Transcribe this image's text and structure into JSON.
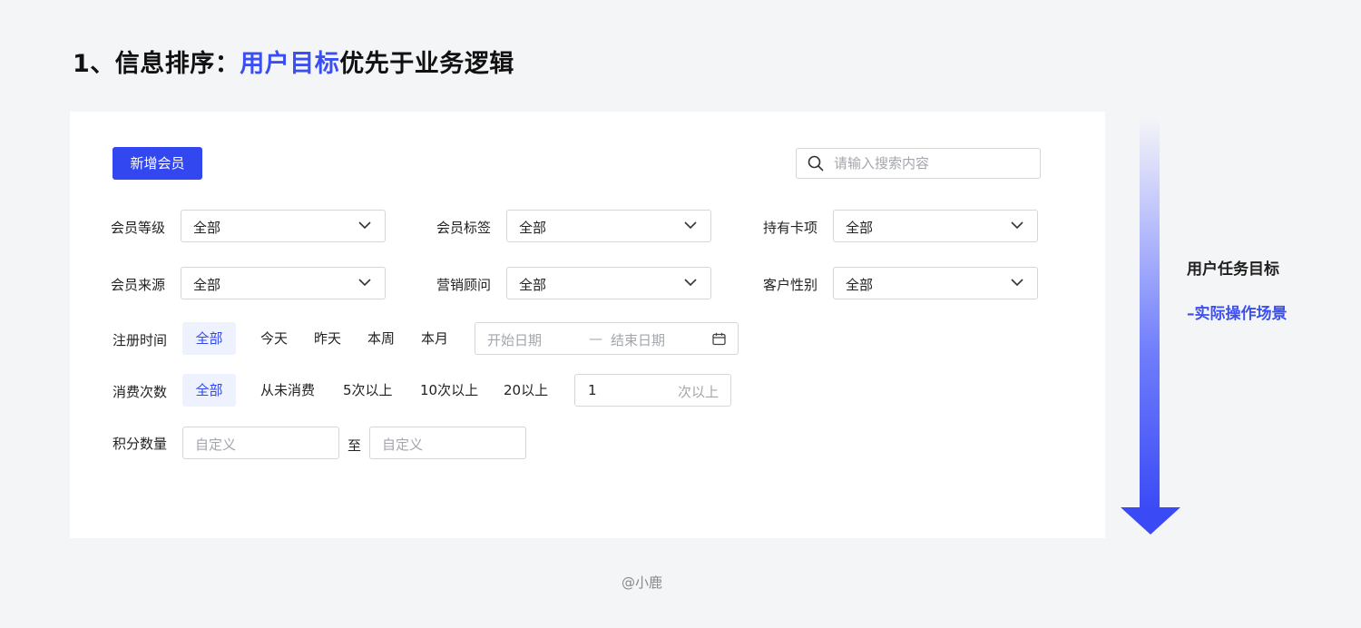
{
  "heading": {
    "prefix": "1、信息排序：",
    "highlight": "用户目标",
    "suffix": "优先于业务逻辑"
  },
  "toolbar": {
    "add_member_label": "新增会员",
    "search_placeholder": "请输入搜索内容"
  },
  "filters": {
    "member_level": {
      "label": "会员等级",
      "value": "全部"
    },
    "member_tag": {
      "label": "会员标签",
      "value": "全部"
    },
    "card_items": {
      "label": "持有卡项",
      "value": "全部"
    },
    "member_source": {
      "label": "会员来源",
      "value": "全部"
    },
    "sales_advisor": {
      "label": "营销顾问",
      "value": "全部"
    },
    "customer_gender": {
      "label": "客户性别",
      "value": "全部"
    }
  },
  "register_time": {
    "label": "注册时间",
    "options": [
      "全部",
      "今天",
      "昨天",
      "本周",
      "本月"
    ],
    "active": "全部",
    "start_placeholder": "开始日期",
    "separator": "—",
    "end_placeholder": "结束日期"
  },
  "consume_count": {
    "label": "消费次数",
    "options": [
      "全部",
      "从未消费",
      "5次以上",
      "10次以上",
      "20以上"
    ],
    "active": "全部",
    "custom_value": "1",
    "custom_unit": "次以上"
  },
  "points": {
    "label": "积分数量",
    "min_placeholder": "自定义",
    "to_label": "至",
    "max_placeholder": "自定义"
  },
  "side": {
    "title": "用户任务目标",
    "subtitle": "–实际操作场景"
  },
  "credit": "@小鹿",
  "colors": {
    "accent": "#3247f0",
    "highlight_text": "#3b4ef3",
    "active_chip_bg": "#eef2ff",
    "border": "#d4d6da",
    "background": "#f4f5f7"
  },
  "icons": {
    "search": "search-icon",
    "dropdown": "chevron-down-icon",
    "date": "calendar-icon",
    "flow": "arrow-down-icon"
  }
}
